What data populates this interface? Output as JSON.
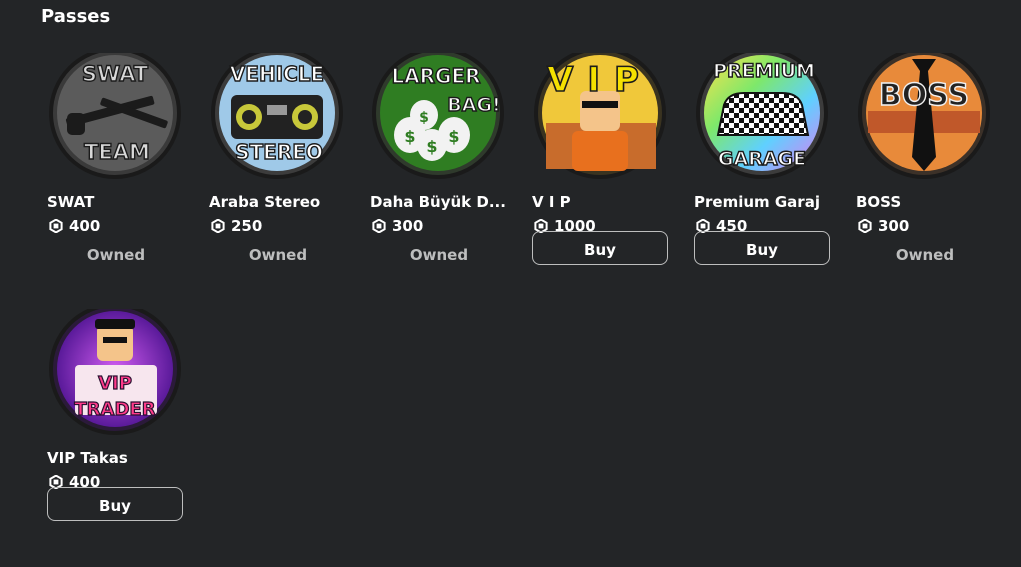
{
  "section": {
    "title": "Passes"
  },
  "passes": [
    {
      "name": "SWAT",
      "price": "400",
      "status": "Owned",
      "icon": "swat-team-badge",
      "badge_lines": [
        "SWAT",
        "TEAM"
      ]
    },
    {
      "name": "Araba Stereo",
      "price": "250",
      "status": "Owned",
      "icon": "vehicle-stereo-badge",
      "badge_lines": [
        "VEHICLE",
        "STEREO"
      ]
    },
    {
      "name": "Daha Büyük D...",
      "price": "300",
      "status": "Owned",
      "icon": "larger-bag-badge",
      "badge_lines": [
        "LARGER",
        "BAG!"
      ]
    },
    {
      "name": "V I P",
      "price": "1000",
      "status": "Buy",
      "icon": "vip-badge",
      "badge_lines": [
        "VIP"
      ]
    },
    {
      "name": "Premium Garaj",
      "price": "450",
      "status": "Buy",
      "icon": "premium-garage-badge",
      "badge_lines": [
        "PREMIUM",
        "GARAGE"
      ]
    },
    {
      "name": "BOSS",
      "price": "300",
      "status": "Owned",
      "icon": "boss-badge",
      "badge_lines": [
        "BOSS"
      ]
    },
    {
      "name": "VIP Takas",
      "price": "400",
      "status": "Buy",
      "icon": "vip-trader-badge",
      "badge_lines": [
        "VIP",
        "TRADER"
      ]
    }
  ],
  "colors": {
    "background": "#232527",
    "text": "#ffffff",
    "muted_text": "#bdbebe",
    "button_border": "#bdbebe"
  }
}
